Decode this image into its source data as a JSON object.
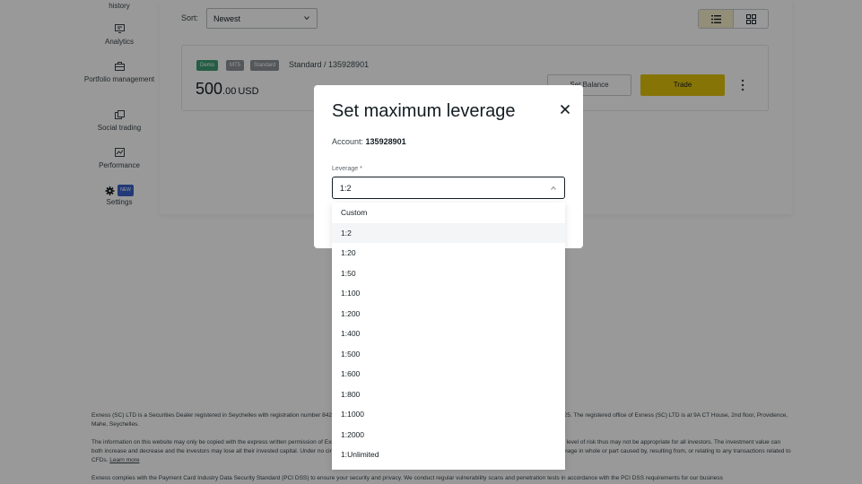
{
  "sidebar": {
    "items": [
      {
        "label": "history",
        "icon": "history-icon"
      },
      {
        "label": "Analytics",
        "icon": "analytics-icon"
      },
      {
        "label": "Portfolio management",
        "icon": "briefcase-icon"
      },
      {
        "label": "Social trading",
        "icon": "social-trading-icon"
      },
      {
        "label": "Performance",
        "icon": "performance-chart-icon"
      },
      {
        "label": "Settings",
        "icon": "gear-icon",
        "badge": "NEW"
      }
    ]
  },
  "toolbar": {
    "sort_label": "Sort:",
    "sort_value": "Newest",
    "view_modes": [
      "list-view-icon",
      "grid-view-icon"
    ],
    "active_view": "list"
  },
  "account_card": {
    "tags": [
      "Demo",
      "MT5",
      "Standard"
    ],
    "name": "Standard / 135928901",
    "balance_int": "500",
    "balance_dec": ".00",
    "currency": "USD",
    "set_balance_label": "Set Balance",
    "trade_label": "Trade"
  },
  "footer": {
    "p1": "Exness (SC) LTD is a Securities Dealer registered in Seychelles with registration number 8423606-1 and authorised by the Financial Services Authority (FSA) with licence number SD025. The registered office of Exness (SC) LTD is at 9A CT House, 2nd floor, Providence, Mahe, Seychelles.",
    "p2": "The information on this website may only be copied with the express written permission of Exness. General Risk Warning: CFDs are leveraged products. Trading in CFDs carries a high level of risk thus may not be appropriate for all investors. The investment value can both increase and decrease and the investors may lose all their invested capital. Under no circumstances shall the Company have any liability to any person or entity for any loss or damage in whole or part caused by, resulting from, or relating to any transactions related to CFDs.",
    "learn_more": "Learn more",
    "p3": "Exness complies with the Payment Card Industry Data Security Standard (PCI DSS) to ensure your security and privacy. We conduct regular vulnerability scans and penetration tests in accordance with the PCI DSS requirements for our business"
  },
  "modal": {
    "title": "Set maximum leverage",
    "account_label": "Account:",
    "account_number": "135928901",
    "leverage_label": "Leverage *",
    "leverage_value": "1:2",
    "options": [
      "Custom",
      "1:2",
      "1:20",
      "1:50",
      "1:100",
      "1:200",
      "1:400",
      "1:500",
      "1:600",
      "1:800",
      "1:1000",
      "1:2000",
      "1:Unlimited"
    ],
    "selected_option": "1:2"
  },
  "colors": {
    "accent": "#e0c20c",
    "demo_tag": "#3f9c74",
    "new_badge": "#3a62c8"
  }
}
